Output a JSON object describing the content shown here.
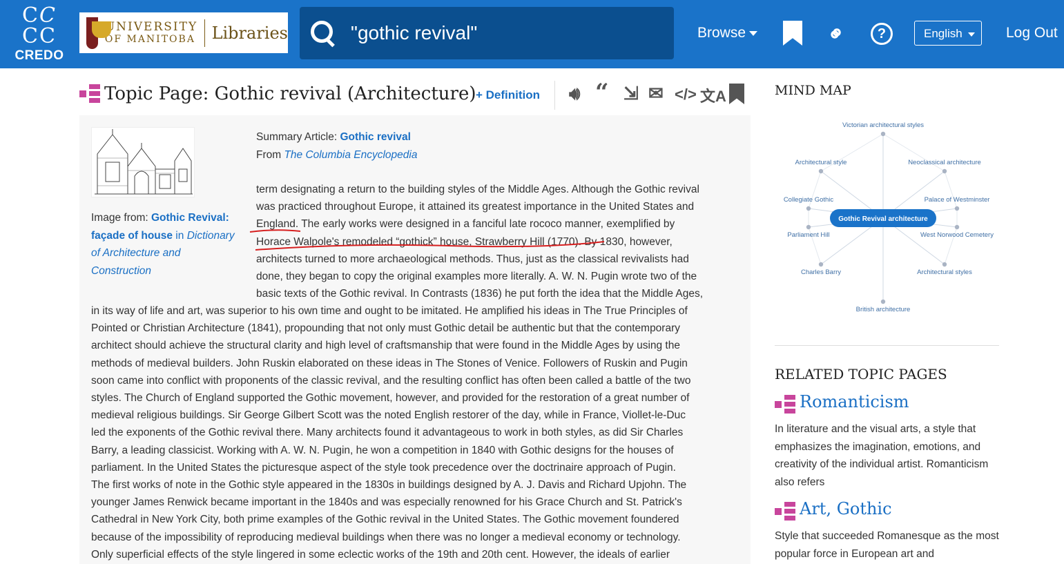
{
  "header": {
    "credo_letters": "C C\nC C",
    "credo_word": "CREDO",
    "um_university": "UNIVERSITY",
    "um_manitoba": "OF MANITOBA",
    "um_libraries": "Libraries",
    "search_value": "\"gothic revival\"",
    "browse_label": "Browse",
    "language": "English",
    "logout_label": "Log Out"
  },
  "page": {
    "title": "Topic Page: Gothic revival (Architecture)",
    "definition_link": "+ Definition",
    "summary_prefix": "Summary Article: ",
    "summary_link": "Gothic revival",
    "from_prefix": "From ",
    "from_source": "The Columbia Encyclopedia",
    "caption_prefix": "Image from: ",
    "caption_link1": "Gothic Revival:",
    "caption_link2": "façade of house",
    "caption_in": " in ",
    "caption_book1": "Dictionary",
    "caption_book2": "of Architecture and",
    "caption_book3": "Construction"
  },
  "article_lines_right": [
    "term designating a return to the building styles of the Middle Ages. Although the Gothic revival",
    "was practiced throughout Europe, it attained its greatest importance in the United States and",
    "England. The early works were designed in a fanciful late rococo manner, exemplified by",
    "Horace Walpole's remodeled “gothick” house, Strawberry Hill (1770). By 1830, however,",
    "architects turned to more archaeological methods. Thus, just as the classical revivalists had",
    "done, they began to copy the original examples more literally. A. W. N. Pugin wrote two of the",
    "basic texts of the Gothic revival. In Contrasts (1836) he put forth the idea that the Middle Ages,"
  ],
  "article_lines_full": [
    "in its way of life and art, was superior to his own time and ought to be imitated. He amplified his ideas in The True Principles of",
    "Pointed or Christian Architecture (1841), propounding that not only must Gothic detail be authentic but that the contemporary",
    "architect should achieve the structural clarity and high level of craftsmanship that were found in the Middle Ages by using the",
    "methods of medieval builders. John Ruskin elaborated on these ideas in The Stones of Venice. Followers of Ruskin and Pugin",
    "soon came into conflict with proponents of the classic revival, and the resulting conflict has often been called a battle of the two",
    "styles. The Church of England supported the Gothic movement, however, and provided for the restoration of a great number of",
    "medieval religious buildings. Sir George Gilbert Scott was the noted English restorer of the day, while in France, Viollet-le-Duc",
    "led the exponents of the Gothic revival there. Many architects found it advantageous to work in both styles, as did Sir Charles",
    "Barry, a leading classicist. Working with A. W. N. Pugin, he won a competition in 1840 with Gothic designs for the houses of",
    "parliament. In the United States the picturesque aspect of the style took precedence over the doctrinaire approach of Pugin.",
    "The first works of note in the Gothic style appeared in the 1830s in buildings designed by A. J. Davis and Richard Upjohn. The",
    "younger James Renwick became important in the 1840s and was especially renowned for his Grace Church and St. Patrick's",
    "Cathedral in New York City, both prime examples of the Gothic revival in the United States. The Gothic movement foundered",
    "because of the impossibility of reproducing medieval buildings when there was no longer a medieval economy or technology.",
    "Only superficial effects of the style lingered in some eclectic works of the 19th and 20th cent. However, the ideals of earlier"
  ],
  "sidebar": {
    "mind_map_title": "MIND MAP",
    "mind_map_center": "Gothic Revival architecture",
    "mind_map_nodes": [
      "Victorian architectural styles",
      "Neoclassical architecture",
      "Palace of Westminster",
      "West Norwood Cemetery",
      "Architectural styles",
      "British architecture",
      "Charles Barry",
      "Parliament Hill",
      "Collegiate Gothic",
      "Architectural style"
    ],
    "related_title": "RELATED TOPIC PAGES",
    "related": [
      {
        "title": "Romanticism",
        "snippet": "In literature and the visual arts, a style that emphasizes the imagination, emotions, and creativity of the individual artist. Romanticism also refers"
      },
      {
        "title": "Art, Gothic",
        "snippet": "Style that succeeded Romanesque as the most popular force in European art and"
      }
    ]
  },
  "colors": {
    "header_bg": "#1a73c9",
    "search_bg": "#0b4f8f",
    "link": "#1a6fc4",
    "topic_icon": "#c8459c",
    "underline": "#d61f1f"
  }
}
